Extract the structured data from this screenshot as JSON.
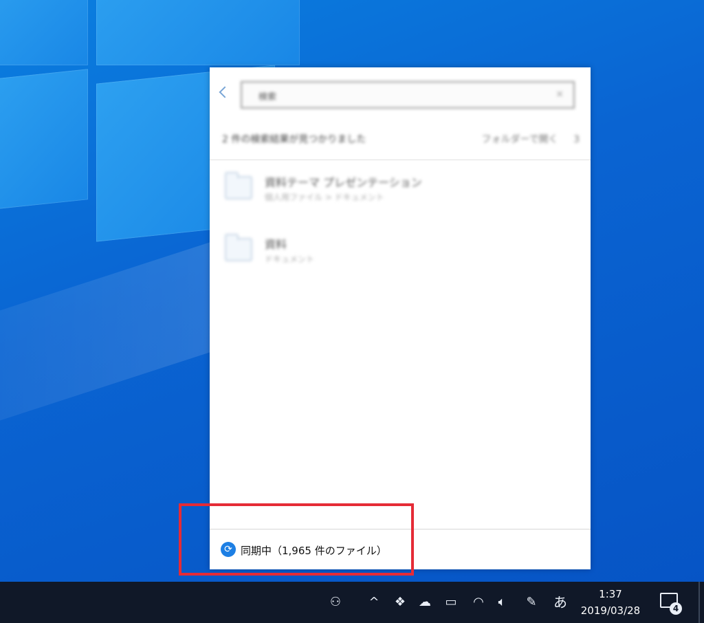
{
  "panel": {
    "search_text": "検索",
    "search_clear": "×",
    "result_summary": "2 件の検索結果が見つかりました",
    "result_link": "フォルダーで開く",
    "result_count_right": "3",
    "items": [
      {
        "name": "資料テーマ プレゼンテーション",
        "subtitle": "個人用ファイル > ドキュメント"
      },
      {
        "name": "資料",
        "subtitle": "ドキュメント"
      }
    ],
    "status": {
      "icon": "sync-icon",
      "text": "同期中（1,965 件のファイル）"
    }
  },
  "taskbar": {
    "tray": {
      "people": "people-icon",
      "chevron": "^",
      "dropbox": "dropbox-icon",
      "onedrive": "onedrive-icon",
      "battery": "battery-icon",
      "wifi": "wifi-icon",
      "volume": "volume-icon",
      "pen": "pen-icon",
      "ime": "あ"
    },
    "clock": {
      "time": "1:37",
      "date": "2019/03/28"
    },
    "notifications": {
      "count": "4"
    }
  },
  "colors": {
    "accent": "#1d7fe4",
    "highlight": "#e52b36",
    "taskbar": "#101828"
  }
}
